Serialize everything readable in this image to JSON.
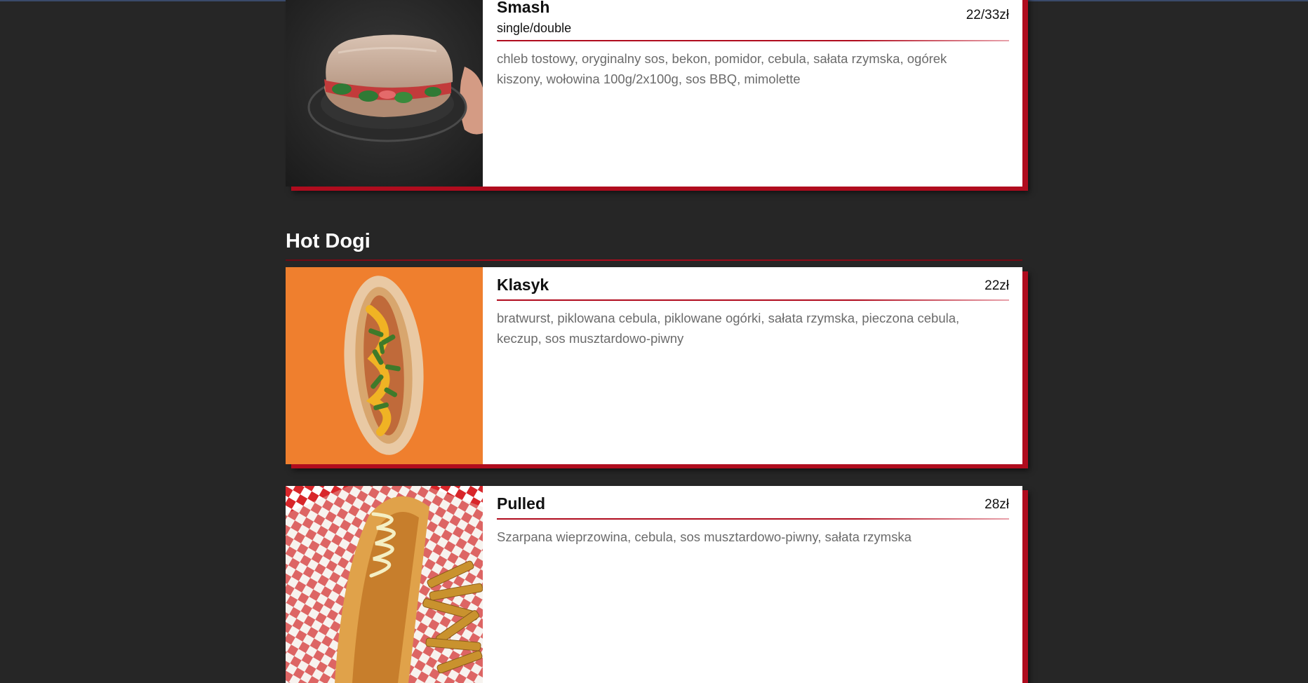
{
  "sections": [
    {
      "title": "",
      "items": [
        {
          "name": "Smash",
          "subtitle": "single/double",
          "price": "22/33zł",
          "description": "chleb tostowy, oryginalny sos, bekon, pomidor, cebula, sałata rzymska, ogórek kiszony, wołowina 100g/2x100g, sos BBQ, mimolette",
          "image_icon": "sandwich-photo"
        }
      ]
    },
    {
      "title": "Hot Dogi",
      "items": [
        {
          "name": "Klasyk",
          "subtitle": "",
          "price": "22zł",
          "description": "bratwurst, piklowana cebula, piklowane ogórki, sałata rzymska, pieczona cebula, keczup, sos musztardowo-piwny",
          "image_icon": "hotdog-orange-photo"
        },
        {
          "name": "Pulled",
          "subtitle": "",
          "price": "28zł",
          "description": "Szarpana wieprzowina, cebula, sos musztardowo-piwny, sałata rzymska",
          "image_icon": "hotdog-fries-photo"
        }
      ]
    }
  ],
  "colors": {
    "background": "#262626",
    "accent": "#b00c1e",
    "card": "#ffffff",
    "description_text": "#6b6b6b"
  }
}
